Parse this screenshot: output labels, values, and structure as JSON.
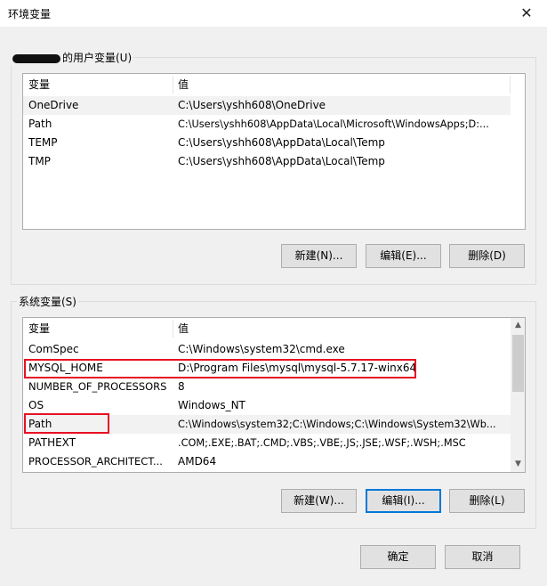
{
  "window": {
    "title": "环境变量",
    "close_glyph": "✕"
  },
  "user_vars": {
    "label": "的用户变量(U)",
    "columns": [
      "变量",
      "值"
    ],
    "rows": [
      {
        "name": "OneDrive",
        "value": "C:\\Users\\yshh608\\OneDrive"
      },
      {
        "name": "Path",
        "value": "C:\\Users\\yshh608\\AppData\\Local\\Microsoft\\WindowsApps;D:..."
      },
      {
        "name": "TEMP",
        "value": "C:\\Users\\yshh608\\AppData\\Local\\Temp"
      },
      {
        "name": "TMP",
        "value": "C:\\Users\\yshh608\\AppData\\Local\\Temp"
      }
    ],
    "buttons": {
      "new": "新建(N)...",
      "edit": "编辑(E)...",
      "delete": "删除(D)"
    }
  },
  "system_vars": {
    "label": "系统变量(S)",
    "columns": [
      "变量",
      "值"
    ],
    "rows": [
      {
        "name": "ComSpec",
        "value": "C:\\Windows\\system32\\cmd.exe"
      },
      {
        "name": "MYSQL_HOME",
        "value": "D:\\Program Files\\mysql\\mysql-5.7.17-winx64"
      },
      {
        "name": "NUMBER_OF_PROCESSORS",
        "value": "8"
      },
      {
        "name": "OS",
        "value": "Windows_NT"
      },
      {
        "name": "Path",
        "value": "C:\\Windows\\system32;C:\\Windows;C:\\Windows\\System32\\Wb..."
      },
      {
        "name": "PATHEXT",
        "value": ".COM;.EXE;.BAT;.CMD;.VBS;.VBE;.JS;.JSE;.WSF;.WSH;.MSC"
      },
      {
        "name": "PROCESSOR_ARCHITECT...",
        "value": "AMD64"
      }
    ],
    "buttons": {
      "new": "新建(W)...",
      "edit": "编辑(I)...",
      "delete": "删除(L)"
    },
    "scroll_up": "▲",
    "scroll_down": "▼"
  },
  "footer": {
    "ok": "确定",
    "cancel": "取消"
  },
  "colors": {
    "highlight_box": "#e81123",
    "focus_border": "#0078d7"
  }
}
